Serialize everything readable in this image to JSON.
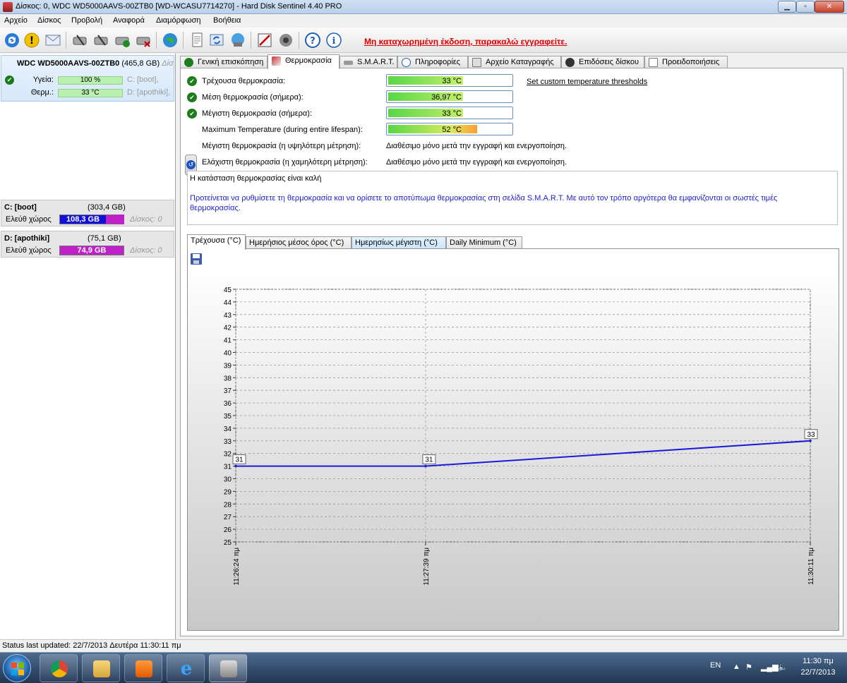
{
  "window": {
    "title": "Δίσκος: 0, WDC WD5000AAVS-00ZTB0 [WD-WCASU7714270]  -  Hard Disk Sentinel 4.40 PRO",
    "min_label": "▁",
    "max_label": "▫",
    "close_label": "✕"
  },
  "menu": [
    "Αρχείο",
    "Δίσκος",
    "Προβολή",
    "Αναφορά",
    "Διαμόρφωση",
    "Βοήθεια"
  ],
  "toolbar": {
    "registration_notice": "Μη καταχωρημένη έκδοση, παρακαλώ εγγραφείτε.",
    "icons": [
      "refresh-icon",
      "warning-icon",
      "mail-icon",
      "disk-test-icon",
      "disk-test-icon",
      "disk-ok-icon",
      "disk-delete-icon",
      "globe-icon",
      "report-icon",
      "sync-icon",
      "monitor-icon",
      "config-icon",
      "speaker-icon",
      "help-icon",
      "info-icon"
    ]
  },
  "disk": {
    "name": "WDC WD5000AAVS-00ZTB0",
    "size": "(465,8 GB)",
    "suffix": "Δίσ",
    "health_label": "Υγεία:",
    "health_value": "100 %",
    "health_fraction": 1.0,
    "temp_label": "Θερμ.:",
    "temp_value": "33 °C",
    "part1": "C: [boot],",
    "part2": "D: [apothiki],"
  },
  "partitions": [
    {
      "name": "C: [boot]",
      "size": "(303,4 GB)",
      "free_label": "Ελεύθ χώρος",
      "free_value": "108,3 GB",
      "disk": "Δίσκος: 0",
      "color": "#1010d8"
    },
    {
      "name": "D: [apothiki]",
      "size": "(75,1 GB)",
      "free_label": "Ελεύθ χώρος",
      "free_value": "74,9 GB",
      "disk": "Δίσκος: 0",
      "color": "#c020c8"
    }
  ],
  "tabs": [
    {
      "label": "Γενική επισκόπηση",
      "icon": "ok-icon"
    },
    {
      "label": "Θερμοκρασία",
      "icon": "thermometer-icon"
    },
    {
      "label": "S.M.A.R.T.",
      "icon": "smart-icon"
    },
    {
      "label": "Πληροφορίες",
      "icon": "info-icon"
    },
    {
      "label": "Αρχείο Καταγραφής",
      "icon": "log-icon"
    },
    {
      "label": "Επιδόσεις δίσκου",
      "icon": "performance-icon"
    },
    {
      "label": "Προειδοποιήσεις",
      "icon": "alerts-icon"
    }
  ],
  "temperature": {
    "rows": [
      {
        "label": "Τρέχουσα θερμοκρασία:",
        "value": "33 °C",
        "fraction": 0.59
      },
      {
        "label": "Μέση θερμοκρασία (σήμερα):",
        "value": "36,97 °C",
        "fraction": 0.59
      },
      {
        "label": "Μέγιστη θερμοκρασία (σήμερα):",
        "value": "33 °C",
        "fraction": 0.59
      },
      {
        "label": "Maximum Temperature (during entire lifespan):",
        "value": "52 °C",
        "fraction": 0.7
      }
    ],
    "custom_link": "Set custom temperature thresholds",
    "max_measured_label": "Μέγιστη θερμοκρασία (η υψηλότερη μέτρηση):",
    "max_measured_note": "Διαθέσιμο μόνο μετά την εγγραφή και ενεργοποίηση.",
    "min_measured_label": "Ελάχιστη θερμοκρασία (η χαμηλότερη μέτρηση):",
    "min_measured_note": "Διαθέσιμο μόνο μετά την εγγραφή και ενεργοποίηση.",
    "status_line": "Η κατάσταση θερμοκρασίας είναι καλή",
    "advice": "Προτείνεται να ρυθμίσετε τη θερμοκρασία και να ορίσετε το αποτύπωμα θερμοκρασίας στη σελίδα S.M.A.R.T. Με αυτό τον τρόπο αργότερα θα εμφανίζονται οι σωστές τιμές θερμοκρασίας."
  },
  "chart_tabs": [
    "Τρέχουσα (°C)",
    "Ημερήσιος μέσος όρος (°C)",
    "Ημερησίως μέγιστη (°C)",
    "Daily Minimum (°C)"
  ],
  "chart_data": {
    "type": "line",
    "x": [
      "11:26:24 πμ",
      "11:27:39 πμ",
      "11:30:11 πμ"
    ],
    "x_seconds": [
      0,
      75,
      227
    ],
    "values": [
      31,
      31,
      33
    ],
    "data_labels": [
      "31",
      "31",
      "33"
    ],
    "ylim": [
      25,
      45
    ],
    "yticks": [
      "25",
      "26",
      "27",
      "28",
      "29",
      "30",
      "31",
      "32",
      "33",
      "34",
      "35",
      "36",
      "37",
      "38",
      "39",
      "40",
      "41",
      "42",
      "43",
      "44",
      "45"
    ],
    "grid": true,
    "line_color": "#1a1ad8"
  },
  "statusbar": {
    "text": "Status last updated: 22/7/2013 Δευτέρα 11:30:11 πμ"
  },
  "taskbar": {
    "lang": "EN",
    "time": "11:30 πμ",
    "date": "22/7/2013",
    "apps": [
      "chrome-icon",
      "file-explorer-icon",
      "media-player-icon",
      "internet-explorer-icon",
      "hard-disk-sentinel-icon"
    ]
  }
}
